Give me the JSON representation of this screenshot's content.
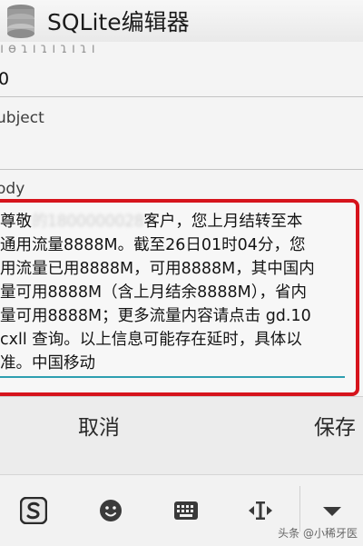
{
  "app": {
    "title": "SQLite编辑器"
  },
  "form": {
    "top_faded_text": "ı ɵ ɿ ı   ɿ ı   ɿ ı ɿ ı",
    "field_value": "0",
    "subject_label": "ubject",
    "body_label": "ody",
    "body": {
      "line1_prefix": "尊敬",
      "line1_blur": "的1800000028",
      "line1_suffix": "客户，您上月结转至本",
      "line2": "通用流量8888M。截至26日01时04分，您",
      "line3": "用流量已用8888M，可用8888M，其中国内",
      "line4": "量可用8888M（含上月结余8888M），省内",
      "line5": "量可用8888M；更多流量内容请点击 gd.10",
      "line6": "cxll 查询。以上信息可能存在延时，具体以",
      "line7": "准。中国移动"
    }
  },
  "actions": {
    "cancel": "取消",
    "save": "保存"
  },
  "keyboard_bar": {
    "icons": [
      "sogou-logo-icon",
      "emoji-icon",
      "keyboard-icon",
      "cursor-icon",
      "collapse-icon"
    ]
  },
  "watermark": "头条 @小稀牙医",
  "colors": {
    "highlight_border": "#d6141c",
    "input_focus": "#2e9fb0"
  }
}
